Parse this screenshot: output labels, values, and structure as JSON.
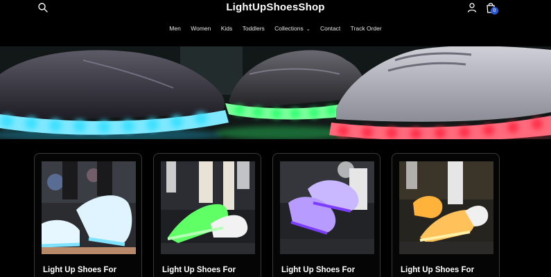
{
  "header": {
    "logo": "LightUpShoesShop",
    "cart_count": "0",
    "icons": {
      "search": "search-icon",
      "account": "account-icon",
      "cart": "cart-icon"
    }
  },
  "nav": {
    "items": [
      {
        "label": "Men"
      },
      {
        "label": "Women"
      },
      {
        "label": "Kids"
      },
      {
        "label": "Toddlers"
      },
      {
        "label": "Collections",
        "has_dropdown": true
      },
      {
        "label": "Contact"
      },
      {
        "label": "Track Order"
      }
    ]
  },
  "products": [
    {
      "title": "Light Up Shoes For"
    },
    {
      "title": "Light Up Shoes For"
    },
    {
      "title": "Light Up Shoes For"
    },
    {
      "title": "Light Up Shoes For"
    }
  ],
  "colors": {
    "background": "#000000",
    "accent_badge": "#2a59d6",
    "glow_cyan": "#3de0ff",
    "glow_green": "#3dff7a",
    "glow_red": "#ff2d4a",
    "glow_orange": "#ffa726",
    "glow_purple": "#9b5cff"
  }
}
